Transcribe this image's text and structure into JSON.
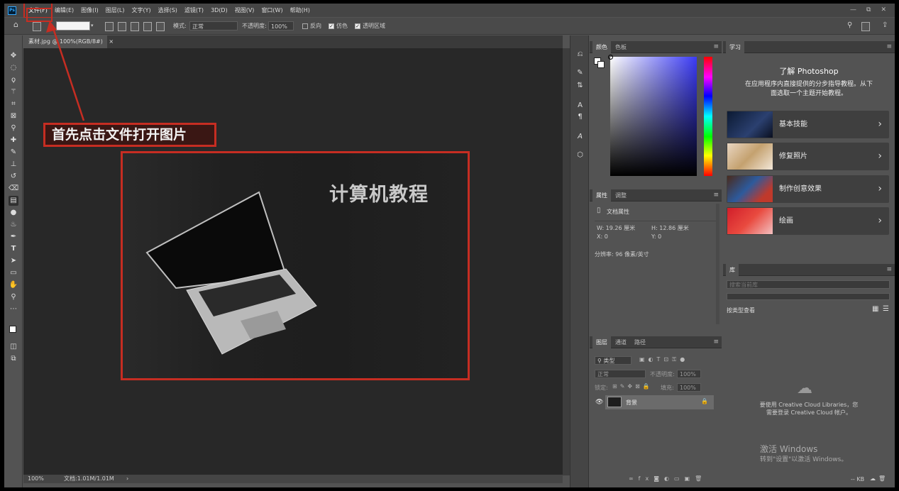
{
  "menubar": {
    "logo": "Ps",
    "items": [
      "文件(F)",
      "编辑(E)",
      "图像(I)",
      "图层(L)",
      "文字(Y)",
      "选择(S)",
      "滤镜(T)",
      "3D(D)",
      "视图(V)",
      "窗口(W)",
      "帮助(H)"
    ],
    "active_index": 0,
    "window_controls": [
      "—",
      "⧉",
      "✕"
    ]
  },
  "options": {
    "mode_label": "模式:",
    "mode_value": "正常",
    "opacity_label": "不透明度:",
    "opacity_value": "100%",
    "reverse_label": "反向",
    "dither_label": "仿色",
    "transparency_label": "透明区域",
    "check_mark": "✓"
  },
  "document": {
    "tab_label": "素材.jpg @ 100%(RGB/8#)",
    "tab_close": "×",
    "image_title": "计算机教程",
    "zoom": "100%",
    "doc_size": "文档:1.01M/1.01M",
    "status_arrow": "›"
  },
  "annotation": {
    "text": "首先点击文件打开图片",
    "color": "#c62d22"
  },
  "color_panel": {
    "tabs": [
      "颜色",
      "色板"
    ]
  },
  "properties_panel": {
    "tabs": [
      "属性",
      "调整"
    ],
    "doc_props": "文档属性",
    "w": "W:  19.26  厘米",
    "h": "H:  12.86  厘米",
    "x": "X:  0",
    "y": "Y:  0",
    "resolution": "分辨率: 96 像素/英寸"
  },
  "layers_panel": {
    "tabs": [
      "图层",
      "通道",
      "路径"
    ],
    "kind_label": "类型",
    "blend": "正常",
    "opacity_label": "不透明度:",
    "opacity_value": "100%",
    "lock_label": "锁定:",
    "fill_label": "填充:",
    "fill_value": "100%",
    "layer_name": "背景"
  },
  "learn_panel": {
    "tab": "学习",
    "title": "了解 Photoshop",
    "desc_line1": "在应用程序内直接提供的分步指导教程。从下",
    "desc_line2": "面选取一个主题开始教程。",
    "cards": [
      "基本技能",
      "修复照片",
      "制作创意效果",
      "绘画"
    ],
    "chevron": "›"
  },
  "library_panel": {
    "tab": "库",
    "search_placeholder": "搜索当前库",
    "view_by": "按类型查看",
    "cc_line1": "要使用 Creative Cloud Libraries，您",
    "cc_line2": "需要登录 Creative Cloud 帐户。",
    "watermark_title": "激活 Windows",
    "watermark_sub": "转到\"设置\"以激活 Windows。",
    "size": "-- KB"
  },
  "colors": {
    "accent_red": "#c62d22",
    "ps_blue": "#31a8ff"
  }
}
